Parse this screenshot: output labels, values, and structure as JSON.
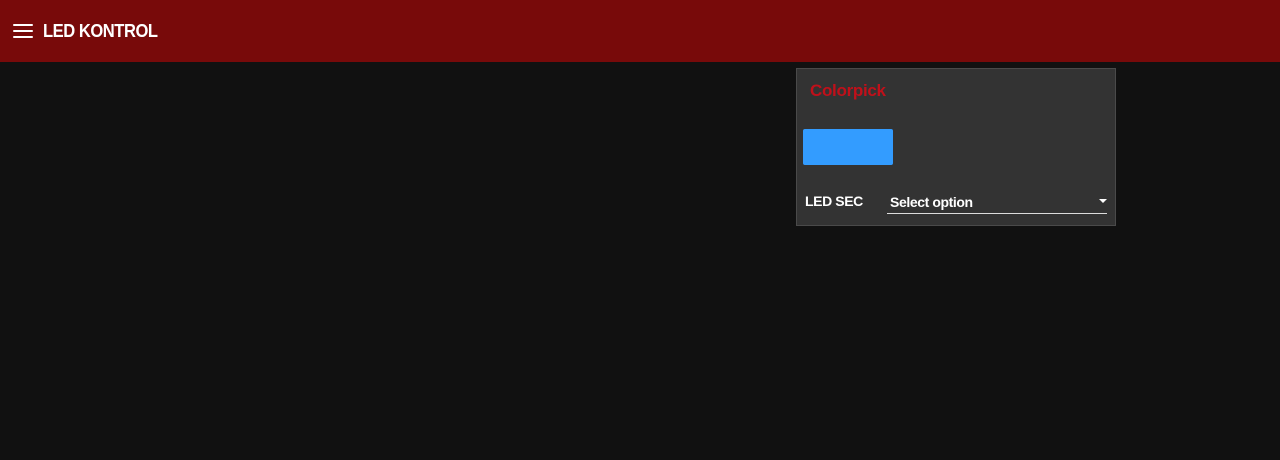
{
  "header": {
    "title": "LED KONTROL",
    "menu_icon": "hamburger-menu-icon",
    "background_color": "#780a0a"
  },
  "card": {
    "title": "Colorpick",
    "title_color": "#c0101a",
    "selected_color": "#339cff",
    "led_row": {
      "label": "LED SEC",
      "select_value": "Select option",
      "dropdown_icon": "caret-down-icon"
    }
  }
}
